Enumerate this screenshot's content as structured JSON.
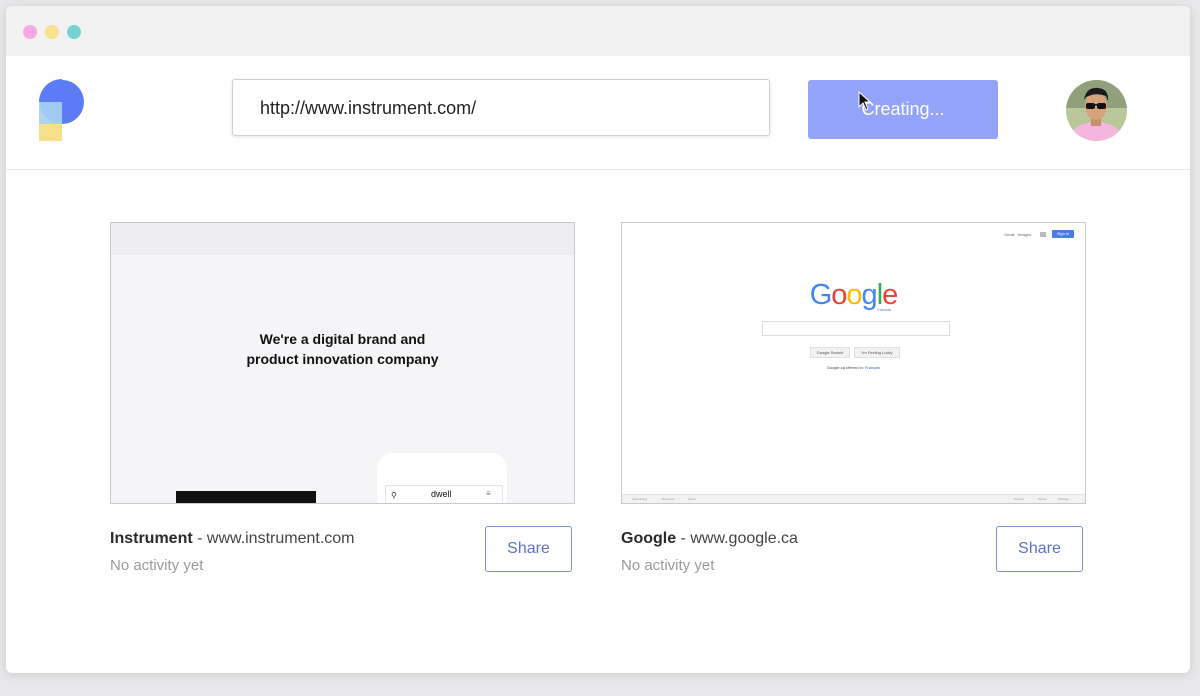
{
  "window": {
    "traffic_lights": [
      "pink",
      "yellow",
      "teal"
    ]
  },
  "toolbar": {
    "url_value": "http://www.instrument.com/",
    "create_button_label": "Creating...",
    "logo_icon": "p-logo-icon",
    "avatar_icon": "user-avatar"
  },
  "cards": [
    {
      "title": "Instrument",
      "separator": " - ",
      "url": "www.instrument.com",
      "activity": "No activity yet",
      "share_label": "Share",
      "preview": {
        "headline_line1": "We're a digital brand and",
        "headline_line2": "product innovation company",
        "phone_text": "dwell"
      }
    },
    {
      "title": "Google",
      "separator": " - ",
      "url": "www.google.ca",
      "activity": "No activity yet",
      "share_label": "Share",
      "preview": {
        "top_links": [
          "Gmail",
          "Images"
        ],
        "sign_in": "Sign in",
        "logo_letters": [
          "G",
          "o",
          "o",
          "g",
          "l",
          "e"
        ],
        "logo_colors": [
          "#4285f4",
          "#ea4335",
          "#fbbc05",
          "#4285f4",
          "#34a853",
          "#ea4335"
        ],
        "region": "Canada",
        "button1": "Google Search",
        "button2": "I'm Feeling Lucky",
        "offered_in": "Google.ca offered in:",
        "offered_lang": "Français",
        "footer_left": [
          "Advertising",
          "Business",
          "About"
        ],
        "footer_right": [
          "Privacy",
          "Terms",
          "Settings"
        ]
      }
    }
  ],
  "colors": {
    "accent": "#93a3f7",
    "share_border": "#7f8fd8",
    "share_text": "#5f72c8"
  }
}
